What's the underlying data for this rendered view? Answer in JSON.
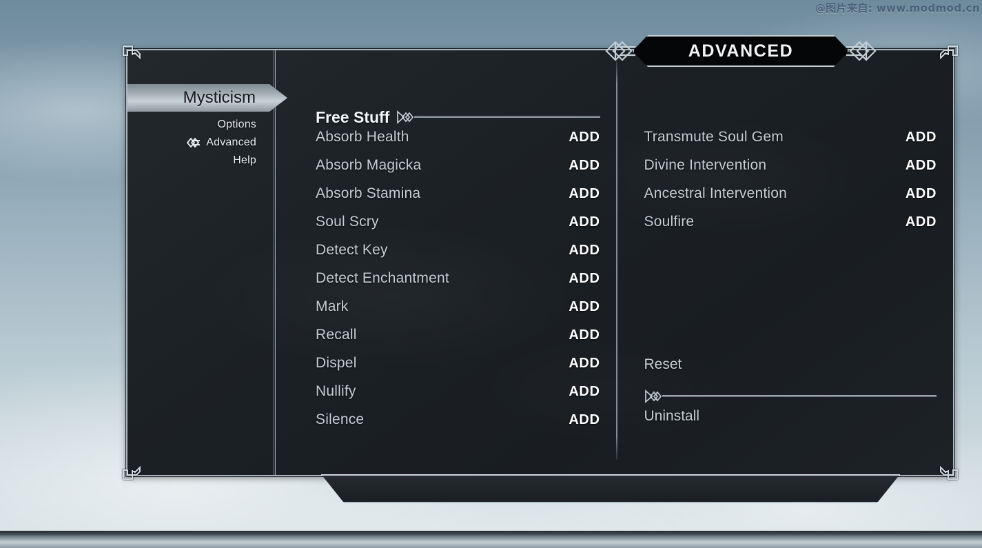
{
  "watermark": "@图片来自: www.modmod.cn",
  "header": {
    "title": "ADVANCED"
  },
  "sidebar": {
    "active_tab": "Mysticism",
    "items": [
      {
        "label": "Options",
        "marked": false
      },
      {
        "label": "Advanced",
        "marked": true
      },
      {
        "label": "Help",
        "marked": false
      }
    ]
  },
  "main": {
    "left_column": {
      "section_title": "Free Stuff",
      "rows": [
        {
          "name": "Absorb Health",
          "action": "ADD"
        },
        {
          "name": "Absorb Magicka",
          "action": "ADD"
        },
        {
          "name": "Absorb Stamina",
          "action": "ADD"
        },
        {
          "name": "Soul Scry",
          "action": "ADD"
        },
        {
          "name": "Detect Key",
          "action": "ADD"
        },
        {
          "name": "Detect Enchantment",
          "action": "ADD"
        },
        {
          "name": "Mark",
          "action": "ADD"
        },
        {
          "name": "Recall",
          "action": "ADD"
        },
        {
          "name": "Dispel",
          "action": "ADD"
        },
        {
          "name": "Nullify",
          "action": "ADD"
        },
        {
          "name": "Silence",
          "action": "ADD"
        }
      ]
    },
    "right_column": {
      "rows": [
        {
          "name": "Transmute Soul Gem",
          "action": "ADD"
        },
        {
          "name": "Divine Intervention",
          "action": "ADD"
        },
        {
          "name": "Ancestral Intervention",
          "action": "ADD"
        },
        {
          "name": "Soulfire",
          "action": "ADD"
        }
      ],
      "reset_label": "Reset",
      "section_title": "",
      "uninstall_label": "Uninstall"
    }
  },
  "colors": {
    "frame_border": "#aab6bf",
    "panel_bg": "#1c2125",
    "text_primary": "#c6ced4",
    "text_action": "#ffffff",
    "accent_highlight": "#c9d1d6"
  }
}
